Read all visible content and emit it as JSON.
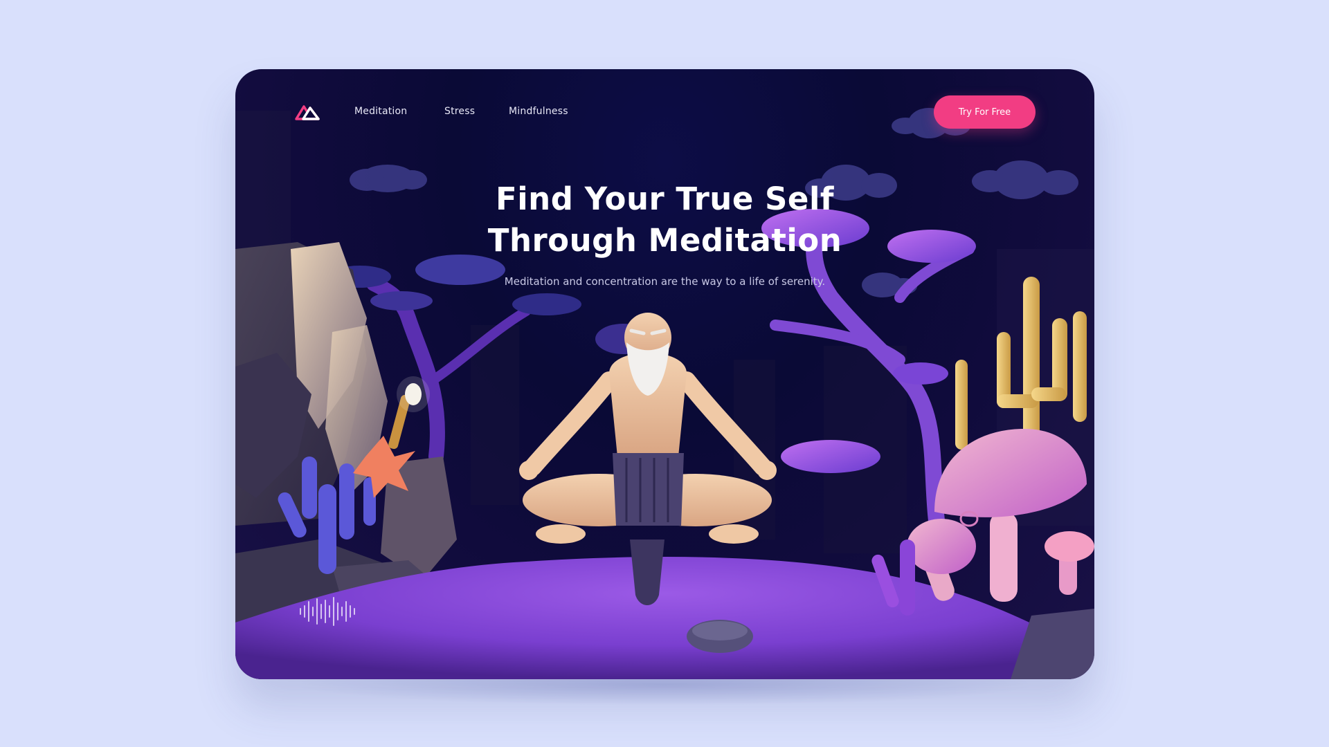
{
  "nav": {
    "links": [
      {
        "label": "Meditation"
      },
      {
        "label": "Stress"
      },
      {
        "label": "Mindfulness"
      }
    ],
    "cta_label": "Try For Free"
  },
  "hero": {
    "title_line1": "Find Your True Self",
    "title_line2": "Through Meditation",
    "subtitle": "Meditation and concentration are the way to a life of serenity."
  },
  "icons": {
    "logo": "mountain-logo-icon",
    "sound": "sound-wave-icon"
  },
  "colors": {
    "page_bg": "#d9e0fc",
    "card_bg": "#0a0a36",
    "accent": "#f23d83",
    "ground": "#7a3fd0"
  }
}
